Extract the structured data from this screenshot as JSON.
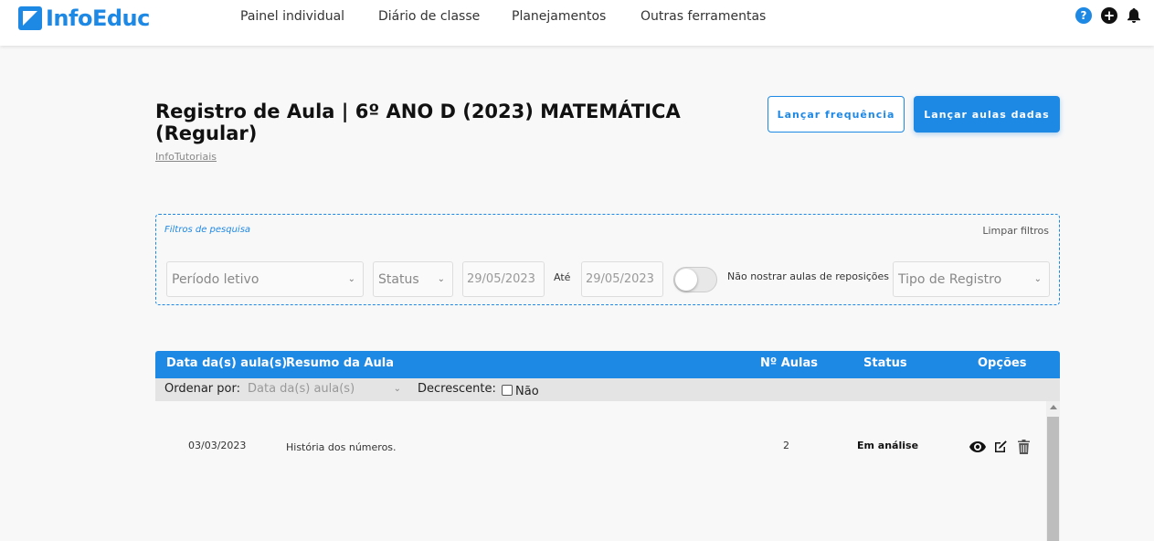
{
  "app": {
    "logo_text": "InfoEduc",
    "brand_color": "#1e88e5"
  },
  "nav": {
    "items": [
      {
        "label": "Painel individual"
      },
      {
        "label": "Diário de classe"
      },
      {
        "label": "Planejamentos"
      },
      {
        "label": "Outras ferramentas"
      }
    ],
    "icons": [
      "help-icon",
      "plus-circle-icon",
      "bell-icon"
    ]
  },
  "page": {
    "title_line1": "Registro de Aula | 6º ANO D (2023) MATEMÁTICA",
    "title_line2": "(Regular)",
    "subtitle_link": "InfoTutoriais",
    "btn_frequencia": "Lançar frequência",
    "btn_aulas_dadas": "Lançar aulas dadas"
  },
  "filters": {
    "label": "Filtros de pesquisa",
    "clear": "Limpar filtros",
    "periodo": "Período letivo",
    "status": "Status",
    "date_from": "29/05/2023",
    "ate": "Até",
    "date_to": "29/05/2023",
    "toggle_label": "Não nostrar aulas de reposições",
    "toggle_on": false,
    "tipo_registro": "Tipo de Registro"
  },
  "table": {
    "headers": [
      "Data da(s) aula(s)",
      "Resumo da Aula",
      "Nº Aulas",
      "Status",
      "Opções"
    ],
    "sort_label": "Ordenar por:",
    "sort_value": "Data da(s) aula(s)",
    "desc_label": "Decrescente:",
    "desc_value": "Não",
    "rows": [
      {
        "data": "03/03/2023",
        "resumo": "História dos números.",
        "num_aulas": "2",
        "status": "Em análise",
        "options": [
          "eye-icon",
          "edit-icon",
          "trash-icon"
        ]
      }
    ]
  }
}
